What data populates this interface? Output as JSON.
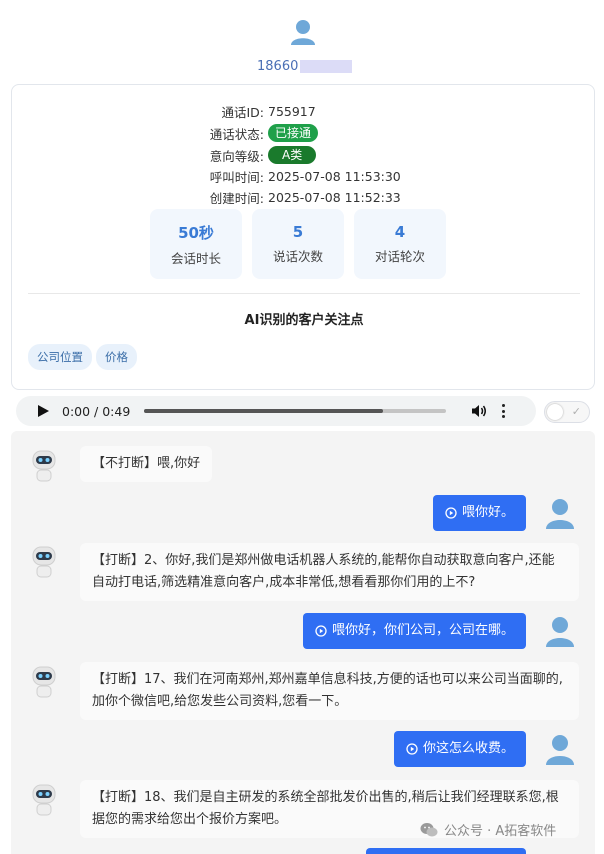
{
  "header": {
    "phone_prefix": "18660"
  },
  "call": {
    "id_label": "通话ID:",
    "id_value": "755917",
    "status_label": "通话状态:",
    "status_value": "已接通",
    "status_color": "#1fa04a",
    "intent_label": "意向等级:",
    "intent_value": "A类",
    "intent_color": "#1a7a2c",
    "call_time_label": "呼叫时间:",
    "call_time_value": "2025-07-08 11:53:30",
    "create_time_label": "创建时间:",
    "create_time_value": "2025-07-08 11:52:33"
  },
  "stats": [
    {
      "value": "50秒",
      "label": "会话时长"
    },
    {
      "value": "5",
      "label": "说话次数"
    },
    {
      "value": "4",
      "label": "对话轮次"
    }
  ],
  "focus": {
    "title": "AI识别的客户关注点",
    "tags": [
      "公司位置",
      "价格"
    ]
  },
  "audio": {
    "time": "0:00 / 0:49",
    "progress": 0.79
  },
  "messages": [
    {
      "side": "left",
      "text": "【不打断】喂,你好"
    },
    {
      "side": "right",
      "text": "喂你好。"
    },
    {
      "side": "left",
      "text": "【打断】2、你好,我们是郑州做电话机器人系统的,能帮你自动获取意向客户,还能自动打电话,筛选精准意向客户,成本非常低,想看看那你们用的上不?"
    },
    {
      "side": "right",
      "text": "喂你好，你们公司，公司在哪。"
    },
    {
      "side": "left",
      "text": "【打断】17、我们在河南郑州,郑州嘉单信息科技,方便的话也可以来公司当面聊的,加你个微信吧,给您发些公司资料,您看一下。"
    },
    {
      "side": "right",
      "text": "你这怎么收费。"
    },
    {
      "side": "left",
      "text": "【打断】18、我们是自主研发的系统全部批发价出售的,稍后让我们经理联系您,根据您的需求给您出个报价方案吧。"
    }
  ],
  "watermark": {
    "text": "公众号 · A拓客软件"
  },
  "colors": {
    "accent": "#2f6ef3",
    "stat_value": "#3a7bd5",
    "tag_bg": "#e8f1fb"
  }
}
